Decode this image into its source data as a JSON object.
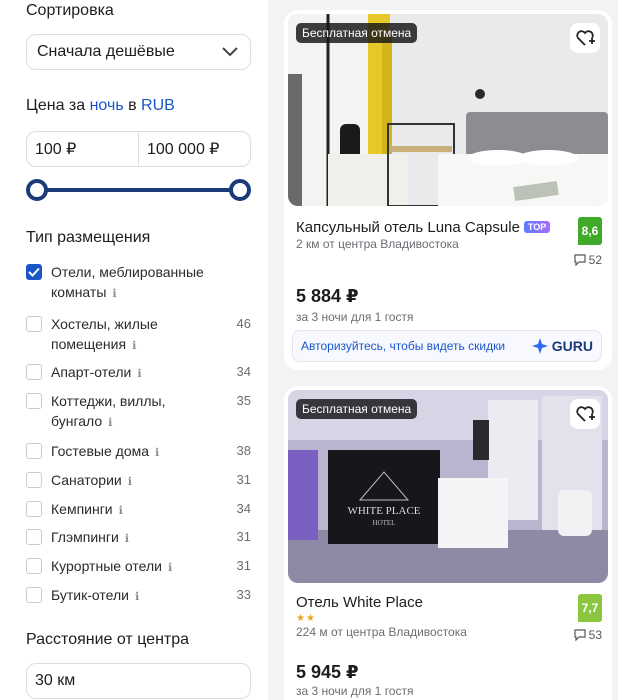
{
  "sidebar": {
    "sort": {
      "title": "Сортировка",
      "value": "Сначала дешёвые"
    },
    "price": {
      "title_prefix": "Цена за ",
      "title_night": "ночь",
      "title_mid": " в ",
      "title_currency": "RUB",
      "min": "100 ₽",
      "max": "100 000 ₽"
    },
    "types": {
      "title": "Тип размещения",
      "items": [
        {
          "label": "Отели, меблированные комнаты",
          "count": "",
          "checked": true
        },
        {
          "label": "Хостелы, жилые помещения",
          "count": "46"
        },
        {
          "label": "Апарт-отели",
          "count": "34"
        },
        {
          "label": "Коттеджи, виллы, бунгало",
          "count": "35"
        },
        {
          "label": "Гостевые дома",
          "count": "38"
        },
        {
          "label": "Санатории",
          "count": "31"
        },
        {
          "label": "Кемпинги",
          "count": "34"
        },
        {
          "label": "Глэмпинги",
          "count": "31"
        },
        {
          "label": "Курортные отели",
          "count": "31"
        },
        {
          "label": "Бутик-отели",
          "count": "33"
        }
      ]
    },
    "distance": {
      "title": "Расстояние от центра",
      "value": "30 км"
    }
  },
  "cards": [
    {
      "badge": "Бесплатная отмена",
      "name": "Капсульный отель Luna Capsule",
      "top_label": "TOP",
      "distance": "2 км от центра Владивостока",
      "rating": "8,6",
      "rating_color": "#3faa2a",
      "reviews": "52",
      "price": "5 884 ₽",
      "price_sub": "за 3 ночи для 1 гостя",
      "promo_text": "Авторизуйтесь, чтобы видеть скидки",
      "promo_brand": "GURU"
    },
    {
      "badge": "Бесплатная отмена",
      "name": "Отель White Place",
      "stars": "★★",
      "distance": "224 м от центра Владивостока",
      "rating": "7,7",
      "rating_color": "#8cc63e",
      "reviews": "53",
      "price": "5 945 ₽",
      "price_sub": "за 3 ночи для 1 гостя",
      "sign_line1": "WHITE PLACE",
      "sign_line2": "HOTEL"
    }
  ]
}
